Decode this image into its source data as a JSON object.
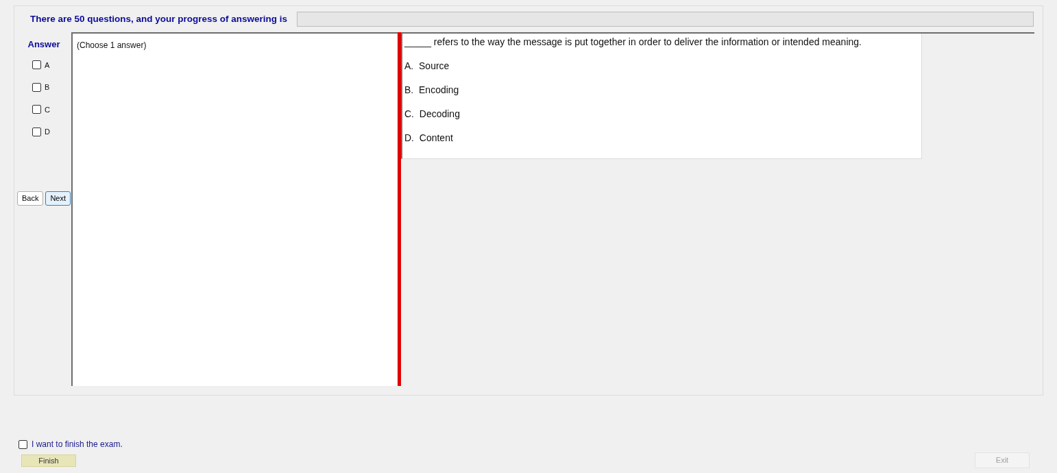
{
  "header": {
    "text": "There are 50 questions, and your progress of answering is",
    "progress": {
      "level": 0
    }
  },
  "answer_panel": {
    "title": "Answer",
    "options": [
      {
        "label": "A",
        "checked": false
      },
      {
        "label": "B",
        "checked": false
      },
      {
        "label": "C",
        "checked": false
      },
      {
        "label": "D",
        "checked": false
      }
    ],
    "buttons": [
      {
        "label": "Back",
        "selected": false
      },
      {
        "label": "Next",
        "selected": true
      }
    ]
  },
  "answer_area": {
    "hint": "(Choose 1 answer)"
  },
  "question": {
    "text": "_____ refers to the way the message is put together in order to deliver the information or intended meaning.",
    "choices": [
      "A.  Source",
      "B.  Encoding",
      "C.  Decoding",
      "D.  Content"
    ]
  },
  "footer": {
    "finish_check": {
      "label": "I want to finish the exam.",
      "checked": false
    },
    "finish_button": {
      "label": "Finish"
    },
    "exit_button": {
      "label": "Exit",
      "disabled": true
    }
  }
}
